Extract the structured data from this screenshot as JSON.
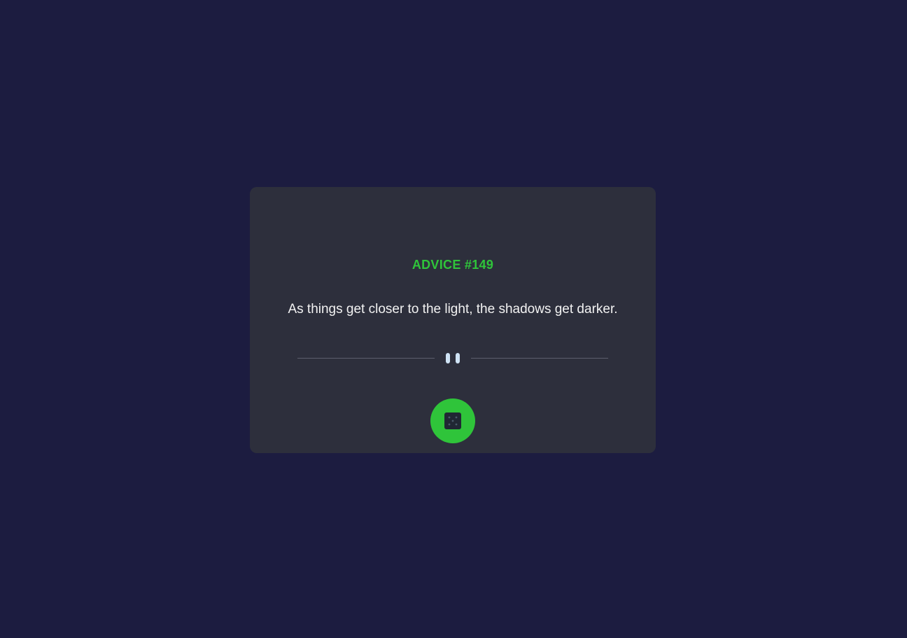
{
  "advice": {
    "heading": "ADVICE #149",
    "text": "As things get closer to the light, the shadows get darker."
  },
  "icons": {
    "divider": "pause-icon",
    "generate": "dice-icon"
  },
  "colors": {
    "background": "#1c1c40",
    "card": "#2d2f3c",
    "accent": "#2fc43a",
    "text": "#f2f2f2",
    "divider": "#5c5f6e",
    "pause_icon": "#cfe3f5",
    "dice": "#202733"
  }
}
